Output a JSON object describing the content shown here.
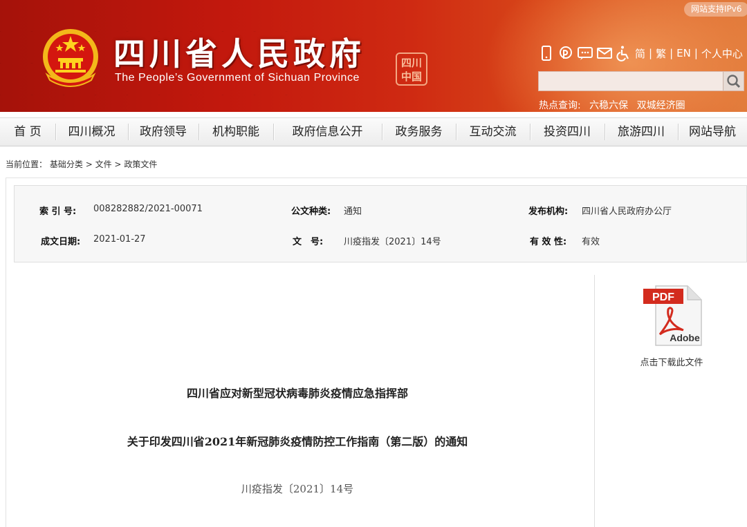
{
  "header": {
    "title_cn": "四川省人民政府",
    "title_en": "The People’s Government of Sichuan Province",
    "seal_text": "四川中国",
    "ipv6_badge": "网站支持IPv6",
    "lang_simplified": "简",
    "lang_traditional": "繁",
    "lang_en": "EN",
    "personal_center": "个人中心",
    "search_placeholder": "",
    "hot_label": "热点查询:",
    "hot_links": [
      "六稳六保",
      "双城经济圈"
    ],
    "icons": [
      "mobile-icon",
      "weibo-icon",
      "wechat-icon",
      "mail-icon",
      "accessibility-icon"
    ]
  },
  "nav": {
    "items": [
      "首 页",
      "四川概况",
      "政府领导",
      "机构职能",
      "政府信息公开",
      "政务服务",
      "互动交流",
      "投资四川",
      "旅游四川",
      "网站导航"
    ]
  },
  "breadcrumb": {
    "prefix": "当前位置：",
    "items": [
      "基础分类",
      "文件",
      "政策文件"
    ],
    "separator": ">"
  },
  "meta": {
    "index_label": "索 引 号:",
    "index_value": "008282882/2021-00071",
    "type_label": "公文种类:",
    "type_value": "通知",
    "issuer_label": "发布机构:",
    "issuer_value": "四川省人民政府办公厅",
    "date_label": "成文日期:",
    "date_value": "2021-01-27",
    "doc_no_label": "文　号:",
    "doc_no_value": "川疫指发〔2021〕14号",
    "validity_label": "有 效 性:",
    "validity_value": "有效"
  },
  "download": {
    "pdf_badge": "PDF",
    "brand": "Adobe",
    "label": "点击下载此文件"
  },
  "document": {
    "org": "四川省应对新型冠状病毒肺炎疫情应急指挥部",
    "title": "关于印发四川省2021年新冠肺炎疫情防控工作指南（第二版）的通知",
    "number": "川疫指发〔2021〕14号"
  },
  "colors": {
    "banner_red": "#c2180d",
    "pdf_red": "#d32b1e"
  }
}
